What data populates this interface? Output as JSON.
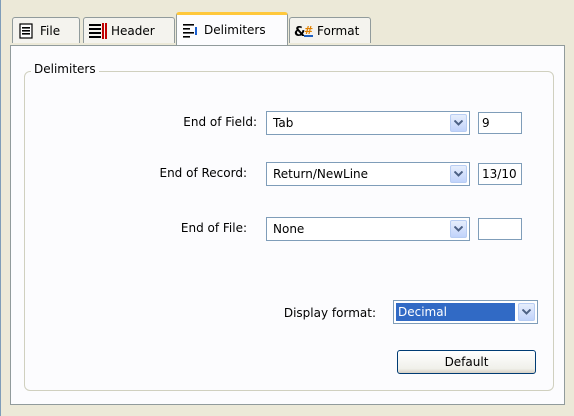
{
  "tabs": [
    {
      "label": "File",
      "icon": "file-icon",
      "active": false
    },
    {
      "label": "Header",
      "icon": "header-icon",
      "active": false
    },
    {
      "label": "Delimiters",
      "icon": "delimiters-icon",
      "active": true
    },
    {
      "label": "Format",
      "icon": "format-icon",
      "active": false
    }
  ],
  "group": {
    "title": "Delimiters"
  },
  "fields": {
    "end_of_field": {
      "label": "End of Field:",
      "value": "Tab",
      "code": "9"
    },
    "end_of_record": {
      "label": "End of Record:",
      "value": "Return/NewLine",
      "code": "13/10"
    },
    "end_of_file": {
      "label": "End of File:",
      "value": "None",
      "code": ""
    }
  },
  "display_format": {
    "label": "Display format:",
    "value": "Decimal"
  },
  "buttons": {
    "default_label": "Default"
  },
  "colors": {
    "accent_tab": "#ffc83c",
    "selection": "#316ac5",
    "border": "#7f9db9"
  }
}
